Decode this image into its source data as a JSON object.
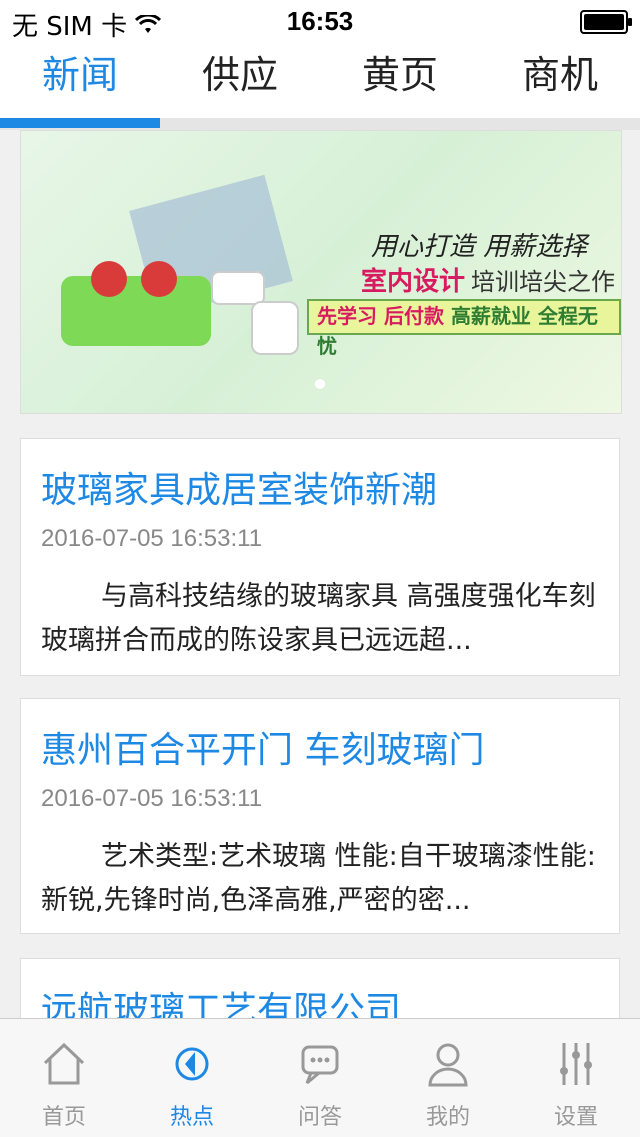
{
  "status_bar": {
    "carrier": "无 SIM 卡",
    "time": "16:53",
    "battery_level": 1.0
  },
  "tabs": [
    {
      "label": "新闻",
      "active": true
    },
    {
      "label": "供应",
      "active": false
    },
    {
      "label": "黄页",
      "active": false
    },
    {
      "label": "商机",
      "active": false
    }
  ],
  "banner": {
    "line1": "用心打造 用薪选择",
    "line2_highlight": "室内设计",
    "line2_rest": "培训培尖之作",
    "line3_a": "先学习",
    "line3_b": "后付款",
    "line3_c": "高薪就业 全程无忧"
  },
  "news": [
    {
      "title": "玻璃家具成居室装饰新潮",
      "date": "2016-07-05 16:53:11",
      "summary": "与高科技结缘的玻璃家具 高强度强化车刻玻璃拼合而成的陈设家具已远远超..."
    },
    {
      "title": "惠州百合平开门 车刻玻璃门",
      "date": "2016-07-05 16:53:11",
      "summary": "艺术类型:艺术玻璃 性能:自干玻璃漆性能:新锐,先锋时尚,色泽高雅,严密的密..."
    },
    {
      "title": "远航玻璃工艺有限公司"
    }
  ],
  "bottom_nav": [
    {
      "label": "首页",
      "icon": "home-icon",
      "active": false
    },
    {
      "label": "热点",
      "icon": "hot-icon",
      "active": true
    },
    {
      "label": "问答",
      "icon": "chat-icon",
      "active": false
    },
    {
      "label": "我的",
      "icon": "user-icon",
      "active": false
    },
    {
      "label": "设置",
      "icon": "settings-icon",
      "active": false
    }
  ],
  "colors": {
    "accent": "#1e88e5",
    "inactive": "#999999"
  }
}
